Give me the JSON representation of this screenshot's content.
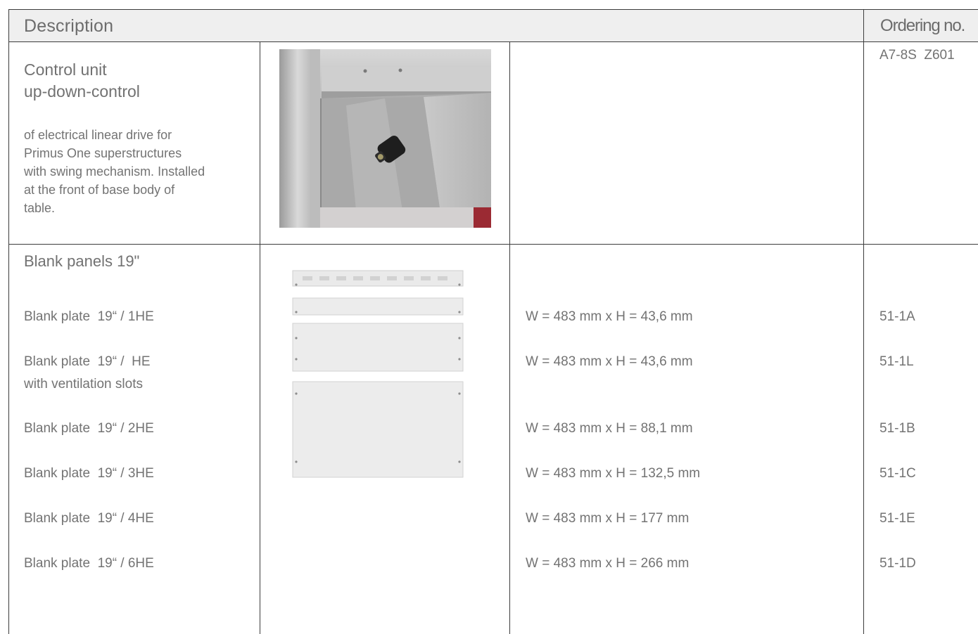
{
  "header": {
    "description": "Description",
    "ordering_no": "Ordering no."
  },
  "control_unit": {
    "title_line1": "Control unit",
    "title_line2": "up-down-control",
    "desc_lines": [
      "of electrical linear drive for",
      "Primus One superstructures",
      "with swing mechanism. Installed",
      "at the front of base body of",
      "table."
    ],
    "ordering_no": "A7-8S  Z601"
  },
  "blank_panels": {
    "title": "Blank panels 19\"",
    "ventilation_note": "with ventilation slots",
    "rows": [
      {
        "label": "Blank plate  19“ / 1HE",
        "dims": "W = 483 mm x H = 43,6 mm",
        "ordering_no": "51-1A"
      },
      {
        "label": "Blank plate  19“ /  HE",
        "dims": "W = 483 mm x H = 43,6 mm",
        "ordering_no": "51-1L"
      },
      {
        "label": "Blank plate  19“ / 2HE",
        "dims": "W = 483 mm x H = 88,1 mm",
        "ordering_no": "51-1B"
      },
      {
        "label": "Blank plate  19“ / 3HE",
        "dims": "W = 483 mm x H = 132,5 mm",
        "ordering_no": "51-1C"
      },
      {
        "label": "Blank plate  19“ / 4HE",
        "dims": "W = 483 mm x H = 177 mm",
        "ordering_no": "51-1E"
      },
      {
        "label": "Blank plate  19“ / 6HE",
        "dims": "W = 483 mm x H = 266 mm",
        "ordering_no": "51-1D"
      }
    ]
  }
}
